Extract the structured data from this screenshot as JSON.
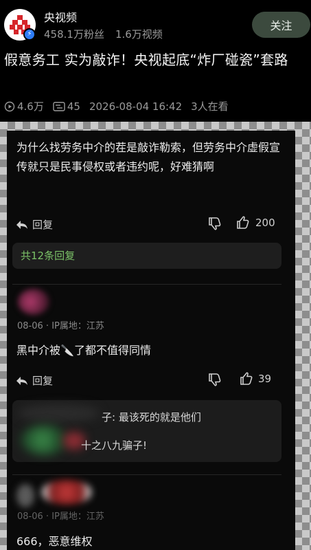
{
  "channel": {
    "name": "央视频",
    "followers": "458.1万粉丝",
    "videos": "1.6万视频",
    "follow_label": "关注",
    "verified_icon": "lightning-icon"
  },
  "video": {
    "title": "假意务工 实为敲诈！央视起底“炸厂碰瓷”套路",
    "plays": "4.6万",
    "danmaku": "45",
    "datetime": "2026-08-04 16:42",
    "watching": "3人在看"
  },
  "comments": [
    {
      "text": "为什么找劳务中介的茬是敲诈勒索，但劳务中介虚假宣传就只是民事侵权或者违约呢，好难猜啊",
      "reply_label": "回复",
      "likes": "200",
      "replies_link": "共12条回复"
    },
    {
      "date": "08-06",
      "location": "IP属地：江苏",
      "text_before": "黑中介被",
      "emoji": "🔪",
      "text_after": "了都不值得同情",
      "reply_label": "回复",
      "likes": "39",
      "sub_replies": [
        {
          "name_fragment": "子:",
          "text": "最该死的就是他们"
        },
        {
          "text": "十之八九骗子!"
        }
      ]
    },
    {
      "date": "08-06",
      "location": "IP属地：江苏",
      "text": "666，恶意维权"
    }
  ],
  "colors": {
    "accent_green": "#7bc267",
    "follow_bg": "#3c4a3e",
    "verified_blue": "#2d7cf6"
  }
}
